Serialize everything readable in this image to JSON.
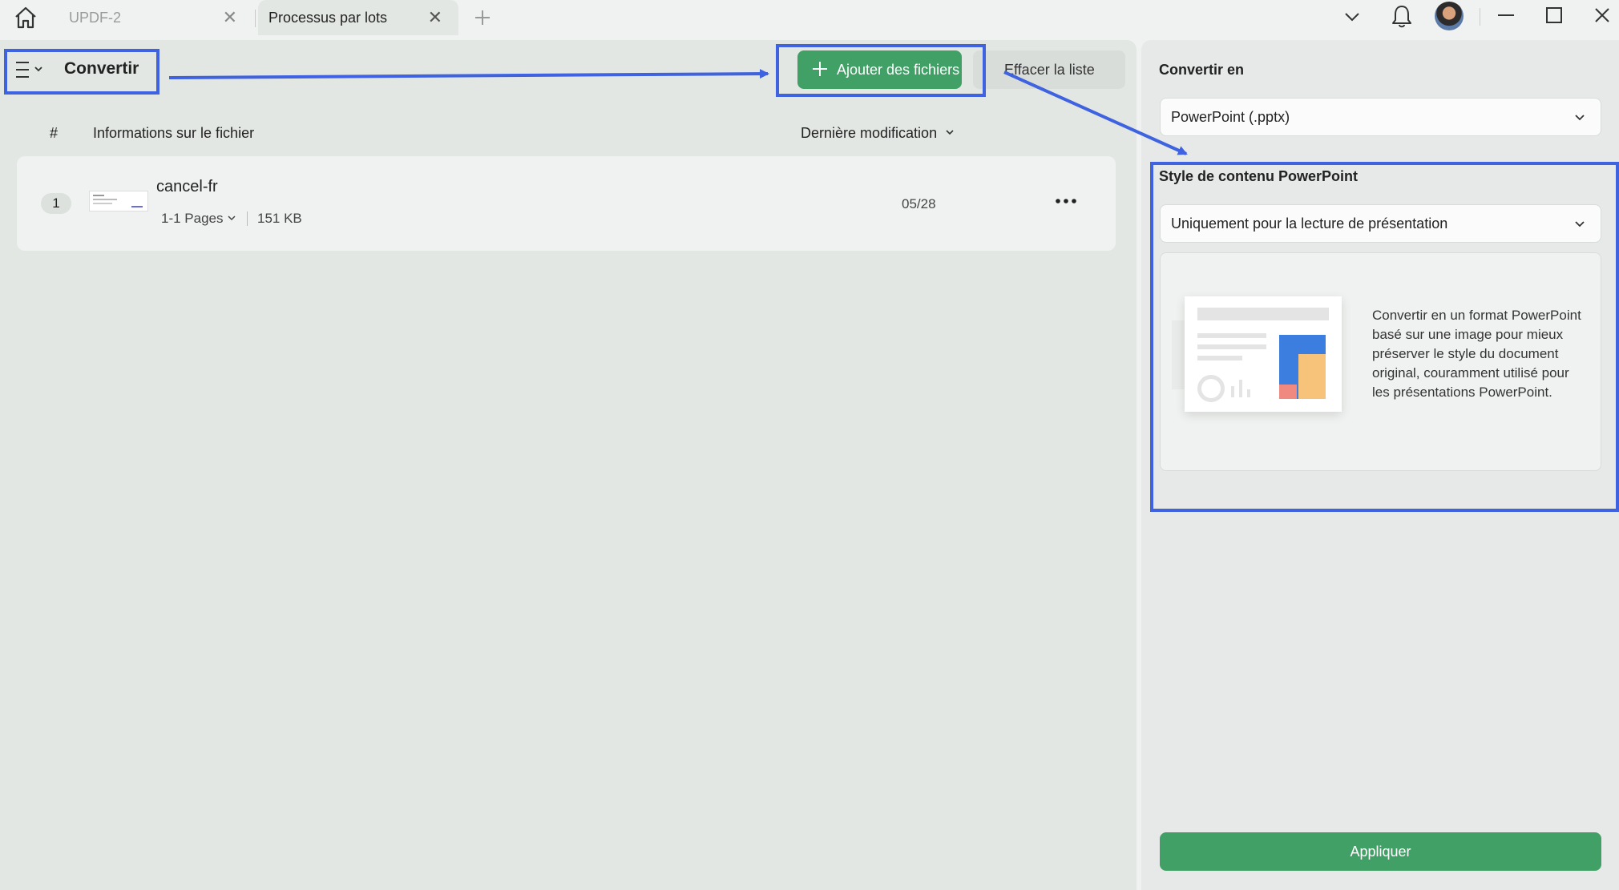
{
  "tabs": [
    {
      "label": "UPDF-2"
    },
    {
      "label": "Processus par lots"
    }
  ],
  "toolbar": {
    "title": "Convertir",
    "add_files": "Ajouter des fichiers",
    "clear_list": "Effacer la liste"
  },
  "table": {
    "col_num": "#",
    "col_info": "Informations sur le fichier",
    "col_modified": "Dernière modification",
    "rows": [
      {
        "index": "1",
        "name": "cancel-fr",
        "pages": "1-1 Pages",
        "size": "151 KB",
        "modified": "05/28"
      }
    ]
  },
  "right": {
    "convert_to_label": "Convertir en",
    "format_value": "PowerPoint (.pptx)",
    "style_label": "Style de contenu PowerPoint",
    "style_value": "Uniquement pour la lecture de présentation",
    "style_description": "Convertir en un format PowerPoint basé sur une image pour mieux préserver le style du document original, couramment utilisé pour les présentations PowerPoint.",
    "apply": "Appliquer"
  },
  "colors": {
    "accent_green": "#41a066",
    "annotation_blue": "#3e62e0"
  }
}
